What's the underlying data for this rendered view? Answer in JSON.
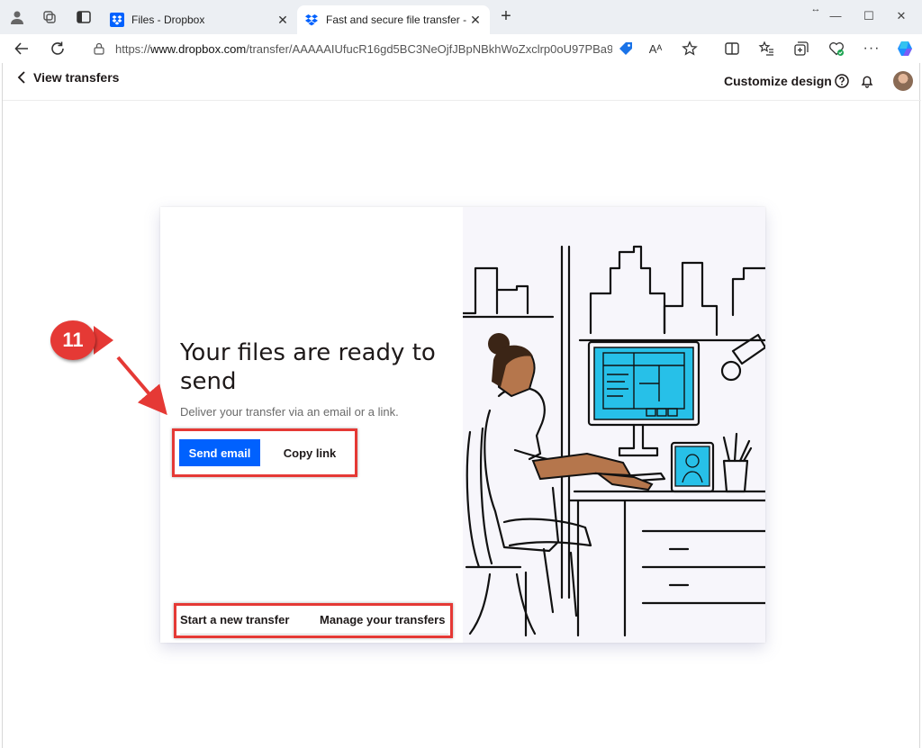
{
  "browser": {
    "tabs": [
      {
        "title": "Files - Dropbox",
        "active": false
      },
      {
        "title": "Fast and secure file transfer - Dro",
        "active": true
      }
    ],
    "url_prefix": "https://",
    "url_domain": "www.dropbox.com",
    "url_path": "/transfer/AAAAAIUfucR16gd5BC3NeOjfJBpNBkhWoZxclrp0oU97PBa9...",
    "resize_hint": "↔"
  },
  "page": {
    "back_label": "View transfers",
    "customize_label": "Customize design"
  },
  "card": {
    "title": "Your files are ready to send",
    "subtitle": "Deliver your transfer via an email or a link.",
    "send_email_label": "Send email",
    "copy_link_label": "Copy link",
    "start_new_label": "Start a new transfer",
    "manage_label": "Manage your transfers"
  },
  "annotation": {
    "step_number": "11",
    "color": "#e53935"
  },
  "colors": {
    "accent": "#0061fe",
    "illustration_screen": "#27c0e8"
  }
}
